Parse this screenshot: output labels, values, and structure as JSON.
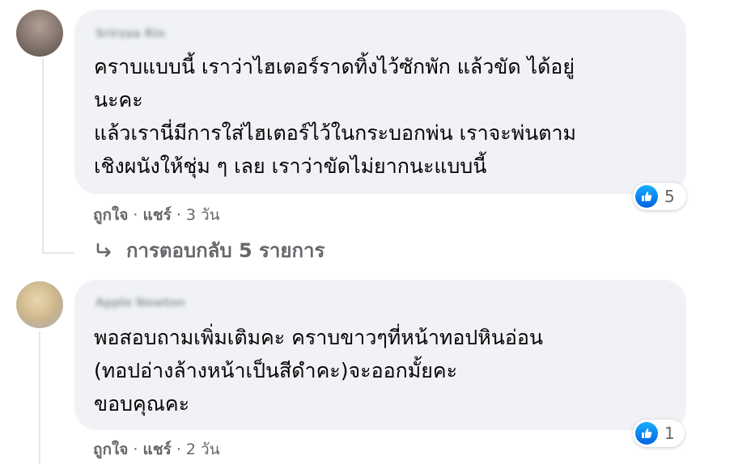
{
  "comments": [
    {
      "author": "Srirzaa Rin",
      "lines": [
        "คราบแบบนี้ เราว่าไฮเตอร์ราดทิ้งไว้ซักพัก แล้วขัด ได้อยู่",
        "นะคะ",
        "แล้วเรานี่มีการใส่ไฮเตอร์ไว้ในกระบอกพ่น เราจะพ่นตาม",
        "เชิงผนังให้ชุ่ม ๆ เลย เราว่าขัดไม่ยากนะแบบนี้"
      ],
      "reaction_icon": "like-icon",
      "reaction_count": "5",
      "like_label": "ถูกใจ",
      "dot": "·",
      "share_label": "แชร์",
      "time": "3 วัน",
      "replies_label": "การตอบกลับ 5 รายการ"
    },
    {
      "author": "Apple Newton",
      "lines": [
        "พอสอบถามเพิ่มเติมคะ คราบขาวๆที่หน้าทอปหินอ่อน",
        "(ทอปอ่างล้างหน้าเป็นสีดำคะ)จะออกมั้ยคะ",
        "ขอบคุณคะ"
      ],
      "reaction_icon": "like-icon",
      "reaction_count": "1",
      "like_label": "ถูกใจ",
      "dot": "·",
      "share_label": "แชร์",
      "time": "2 วัน"
    }
  ],
  "colors": {
    "bubble": "#f0f2f5",
    "text": "#050505",
    "meta": "#65676b",
    "like_gradient_top": "#18afff",
    "like_gradient_bottom": "#0062df"
  }
}
